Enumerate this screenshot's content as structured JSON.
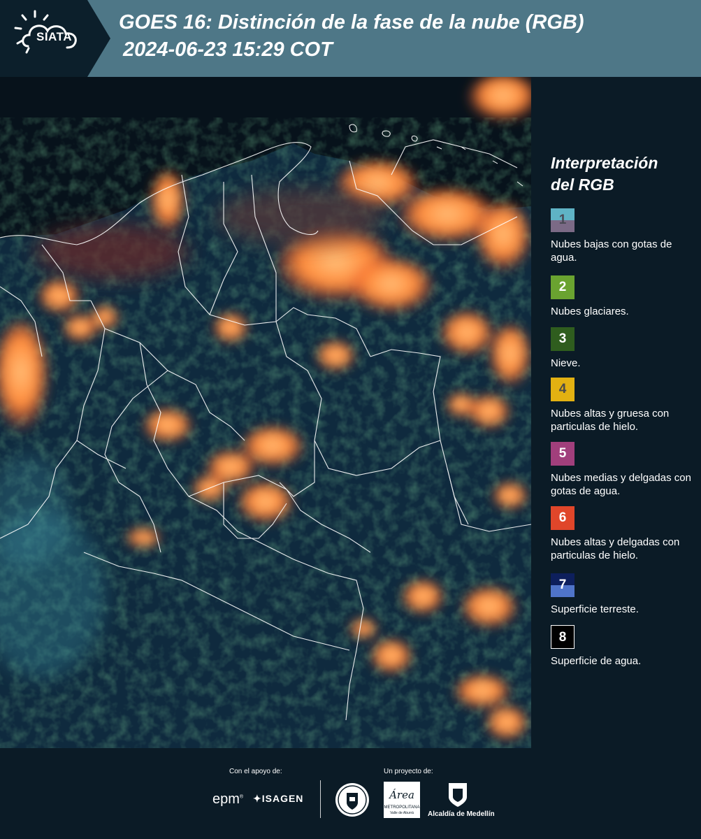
{
  "header": {
    "logo_text": "SIATA",
    "title_line1": "GOES 16: Distinción de la fase de la nube (RGB)",
    "title_line2": "2024-06-23 15:29 COT"
  },
  "legend": {
    "title_line1": "Interpretación",
    "title_line2": "del RGB",
    "items": [
      {
        "number": "1",
        "label": "Nubes bajas con gotas de agua.",
        "color_top": "#5fb3c5",
        "color_bottom": "#7b6a86",
        "number_color": "#4a4a55"
      },
      {
        "number": "2",
        "label": "Nubes glaciares.",
        "color_top": "#6aa330",
        "color_bottom": "#6aa330",
        "number_color": "#ffffff"
      },
      {
        "number": "3",
        "label": "Nieve.",
        "color_top": "#2f5d1e",
        "color_bottom": "#2f5d1e",
        "number_color": "#ffffff"
      },
      {
        "number": "4",
        "label": "Nubes altas y gruesa con particulas de hielo.",
        "color_top": "#e2b112",
        "color_bottom": "#e2b112",
        "number_color": "#4a4a4a"
      },
      {
        "number": "5",
        "label": "Nubes medias y delgadas con gotas de agua.",
        "color_top": "#a13f7c",
        "color_bottom": "#a13f7c",
        "number_color": "#ffffff"
      },
      {
        "number": "6",
        "label": "Nubes altas y delgadas con particulas de hielo.",
        "color_top": "#e0462a",
        "color_bottom": "#e0462a",
        "number_color": "#ffffff"
      },
      {
        "number": "7",
        "label": "Superficie terreste.",
        "color_top": "#0d1f5c",
        "color_bottom": "#4f74c9",
        "number_color": "#ffffff"
      },
      {
        "number": "8",
        "label": "Superficie de agua.",
        "color_top": "#000000",
        "color_bottom": "#000000",
        "number_color": "#ffffff"
      }
    ]
  },
  "footer": {
    "support_label": "Con el apoyo de:",
    "project_label": "Un proyecto de:",
    "epm": "epm",
    "isagen": "ISAGEN",
    "metro_name": "METROPOLITANA",
    "metro_sub": "Valle de Aburrá",
    "metro_script": "Área",
    "alcaldia": "Alcaldía de Medellín"
  },
  "colors": {
    "header_bg": "#4e7787",
    "header_dark": "#0c1f2b",
    "panel_bg": "#0b1b26"
  }
}
